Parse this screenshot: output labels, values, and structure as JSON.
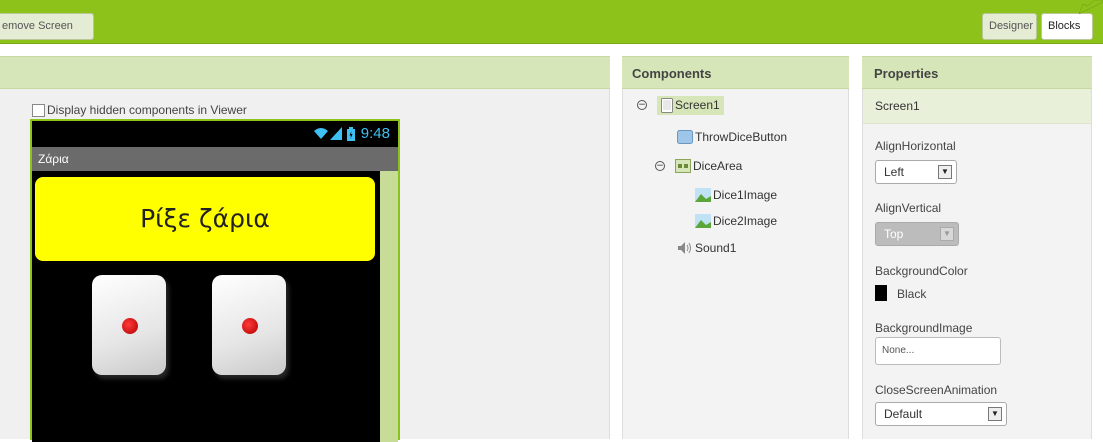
{
  "toolbar": {
    "remove_screen_label": "emove Screen",
    "designer_label": "Designer",
    "blocks_label": "Blocks"
  },
  "viewer": {
    "display_hidden_label": "Display hidden components in Viewer",
    "phone": {
      "status_time": "9:48",
      "screen_title": "Ζάρια",
      "throw_button_text": "Ρίξε ζάρια"
    }
  },
  "components": {
    "header": "Components",
    "tree": [
      {
        "label": "Screen1",
        "icon": "screen-icon"
      },
      {
        "label": "ThrowDiceButton",
        "icon": "button-icon"
      },
      {
        "label": "DiceArea",
        "icon": "arrangement-icon"
      },
      {
        "label": "Dice1Image",
        "icon": "image-icon"
      },
      {
        "label": "Dice2Image",
        "icon": "image-icon"
      },
      {
        "label": "Sound1",
        "icon": "sound-icon"
      }
    ]
  },
  "properties": {
    "header": "Properties",
    "component_name": "Screen1",
    "align_horizontal": {
      "label": "AlignHorizontal",
      "value": "Left"
    },
    "align_vertical": {
      "label": "AlignVertical",
      "value": "Top"
    },
    "background_color": {
      "label": "BackgroundColor",
      "value": "Black"
    },
    "background_image": {
      "label": "BackgroundImage",
      "value": "None..."
    },
    "close_screen_animation": {
      "label": "CloseScreenAnimation",
      "value": "Default"
    }
  },
  "colors": {
    "toolbar_green": "#8cc21a",
    "panel_header": "#d7e6b8",
    "button_yellow": "#ffff00",
    "status_blue": "#3ec1f2"
  }
}
